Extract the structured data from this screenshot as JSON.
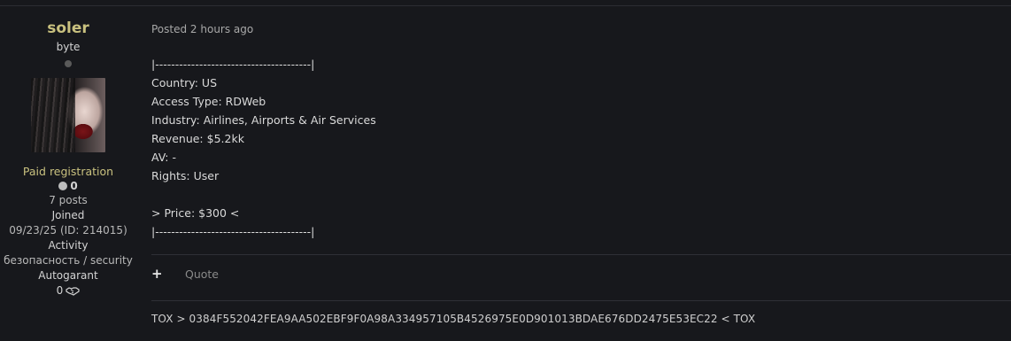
{
  "author": {
    "username": "soler",
    "rank": "byte",
    "group": "Paid registration",
    "reputation": "0",
    "posts": "7 posts",
    "joined_label": "Joined",
    "joined_value": "09/23/25 (ID: 214015)",
    "activity_label": "Activity",
    "activity_value": "безопасность / security",
    "autogarant_label": "Autogarant",
    "autogarant_value": "0"
  },
  "post": {
    "posted": "Posted 2 hours ago",
    "lines": [
      "|---------------------------------------|",
      "Country: US",
      "Access Type: RDWeb",
      "Industry: Airlines, Airports & Air Services",
      "Revenue: $5.2kk",
      "AV: -",
      "Rights: User",
      "",
      "> Price: $300 <",
      "|---------------------------------------|"
    ],
    "actions": {
      "plus": "+",
      "quote": "Quote"
    },
    "signature": "TOX > 0384F552042FEA9AA502EBF9F0A98A334957105B4526975E0D901013BDAE676DD2475E53EC22 < TOX"
  },
  "colors": {
    "accent": "#c9c17f",
    "background": "#17181c"
  }
}
